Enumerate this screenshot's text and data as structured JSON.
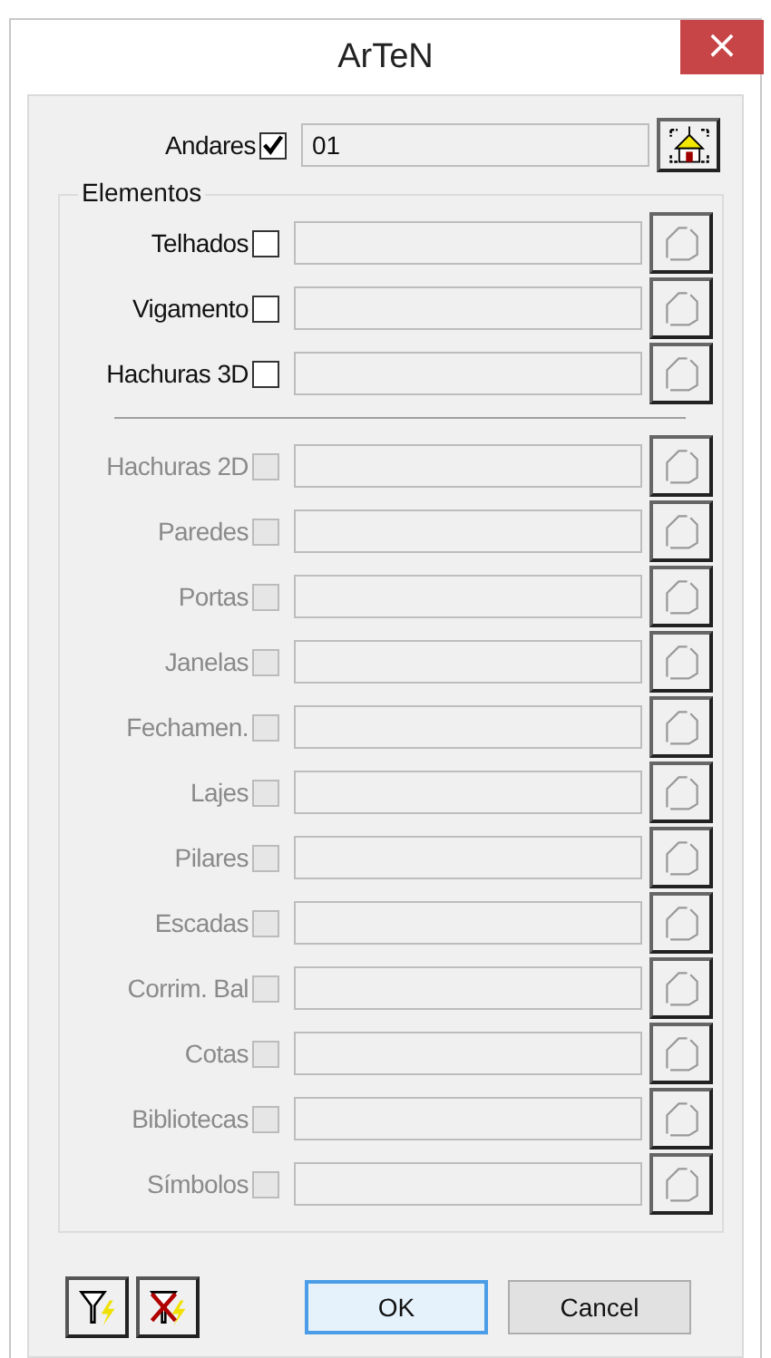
{
  "window": {
    "title": "ArTeN",
    "close": "×"
  },
  "andares": {
    "label": "Andares",
    "checked": true,
    "value": "01"
  },
  "group": {
    "title": "Elementos",
    "primary_rows": [
      {
        "label": "Telhados",
        "checked": false,
        "disabled": false
      },
      {
        "label": "Vigamento",
        "checked": false,
        "disabled": false
      },
      {
        "label": "Hachuras 3D",
        "checked": false,
        "disabled": false
      }
    ],
    "secondary_rows": [
      {
        "label": "Hachuras 2D",
        "checked": false,
        "disabled": true
      },
      {
        "label": "Paredes",
        "checked": false,
        "disabled": true
      },
      {
        "label": "Portas",
        "checked": false,
        "disabled": true
      },
      {
        "label": "Janelas",
        "checked": false,
        "disabled": true
      },
      {
        "label": "Fechamen.",
        "checked": false,
        "disabled": true
      },
      {
        "label": "Lajes",
        "checked": false,
        "disabled": true
      },
      {
        "label": "Pilares",
        "checked": false,
        "disabled": true
      },
      {
        "label": "Escadas",
        "checked": false,
        "disabled": true
      },
      {
        "label": "Corrim. Bal",
        "checked": false,
        "disabled": true
      },
      {
        "label": "Cotas",
        "checked": false,
        "disabled": true
      },
      {
        "label": "Bibliotecas",
        "checked": false,
        "disabled": true
      },
      {
        "label": "Símbolos",
        "checked": false,
        "disabled": true
      }
    ]
  },
  "buttons": [
    {
      "label": "OK",
      "selected": true
    },
    {
      "label": "Cancel",
      "selected": false
    }
  ]
}
